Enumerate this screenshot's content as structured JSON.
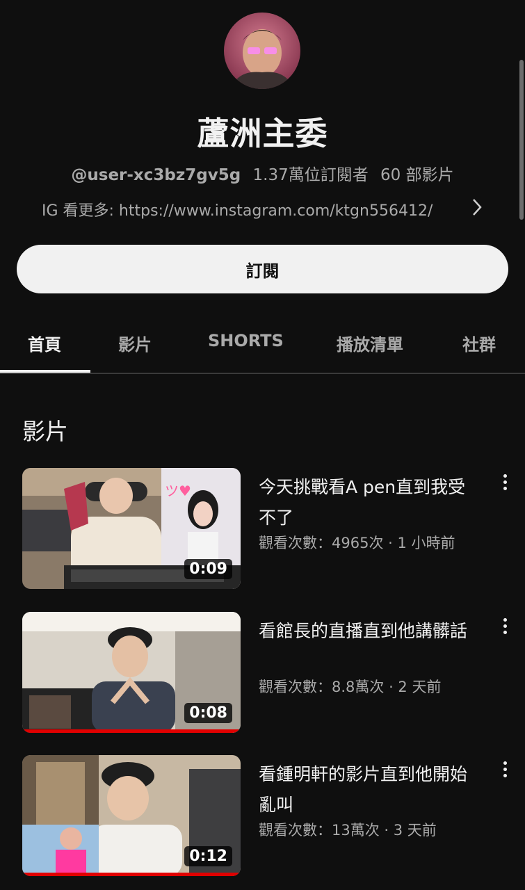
{
  "channel": {
    "name": "蘆洲主委",
    "handle": "@user-xc3bz7gv5g",
    "subscribers": "1.37萬位訂閱者",
    "video_count": "60 部影片",
    "description": "IG 看更多: https://www.instagram.com/ktgn556412/"
  },
  "subscribe_label": "訂閱",
  "tabs": [
    {
      "label": "首頁",
      "active": true
    },
    {
      "label": "影片",
      "active": false
    },
    {
      "label": "SHORTS",
      "active": false
    },
    {
      "label": "播放清單",
      "active": false
    },
    {
      "label": "社群",
      "active": false
    }
  ],
  "section_title": "影片",
  "videos": [
    {
      "title": "今天挑戰看A pen直到我受不了",
      "meta": "觀看次數：4965次 · 1 小時前",
      "duration": "0:09",
      "watched_fraction": 0
    },
    {
      "title": "看館長的直播直到他講髒話",
      "meta": "觀看次數：8.8萬次 · 2 天前",
      "duration": "0:08",
      "watched_fraction": 1
    },
    {
      "title": "看鍾明軒的影片直到他開始亂叫",
      "meta": "觀看次數：13萬次 · 3 天前",
      "duration": "0:12",
      "watched_fraction": 1
    }
  ],
  "colors": {
    "background": "#0f0f0f",
    "text_primary": "#f1f1f1",
    "text_secondary": "#aaaaaa",
    "progress": "#e00000"
  }
}
